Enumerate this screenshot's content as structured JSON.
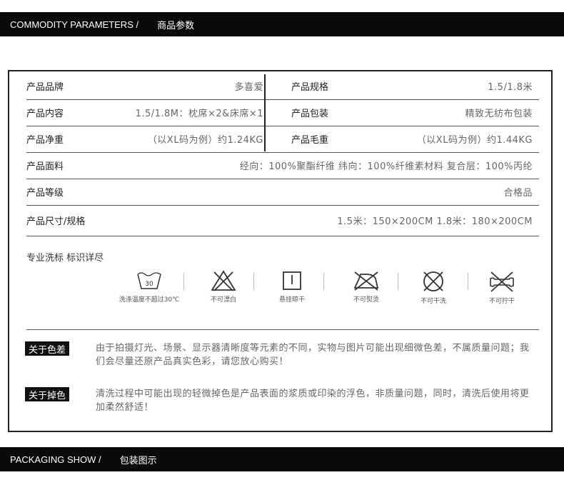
{
  "header_top": {
    "en": "COMMODITY PARAMETERS /",
    "cn": "商品参数"
  },
  "params": [
    {
      "label": "产品品牌",
      "value": "多喜爱",
      "label2": "产品规格",
      "value2": "1.5/1.8米"
    },
    {
      "label": "产品内容",
      "value": "1.5/1.8M：枕席×2&床席×1",
      "label2": "产品包装",
      "value2": "精致无纺布包装"
    },
    {
      "label": "产品净重",
      "value": "（以XL码为例）约1.24KG",
      "label2": "产品毛重",
      "value2": "（以XL码为例）约1.44KG"
    },
    {
      "label": "产品面料",
      "value": "经向：100%聚酯纤维 纬向：100%纤维素材料 复合层：100%丙纶"
    },
    {
      "label": "产品等级",
      "value": "合格品"
    },
    {
      "label": "产品尺寸/规格",
      "value": "1.5米：150×200CM  1.8米：180×200CM"
    }
  ],
  "care": {
    "title": "专业洗标 标识详尽",
    "icons": [
      {
        "icon": "wash-30-icon",
        "caption": "洗涤温度不超过30℃",
        "temp": "30"
      },
      {
        "icon": "no-bleach-icon",
        "caption": "不可漂白"
      },
      {
        "icon": "hang-dry-icon",
        "caption": "悬挂晾干"
      },
      {
        "icon": "no-iron-icon",
        "caption": "不可熨烫"
      },
      {
        "icon": "no-dry-clean-icon",
        "caption": "不可干洗"
      },
      {
        "icon": "no-wring-icon",
        "caption": "不可拧干"
      }
    ]
  },
  "notes": [
    {
      "tag": "关于色差",
      "text": "由于拍摄灯光、场景、显示器清晰度等元素的不同，实物与图片可能出现细微色差，不属质量问题；我们会尽量还原产品真实色彩，请您放心购买！"
    },
    {
      "tag": "关于掉色",
      "text": "清洗过程中可能出现的轻微掉色是产品表面的浆质或印染的浮色，非质量问题，同时，清洗后使用将更加柔然舒适！"
    }
  ],
  "header_bottom": {
    "en": "PACKAGING SHOW /",
    "cn": "包装图示"
  }
}
